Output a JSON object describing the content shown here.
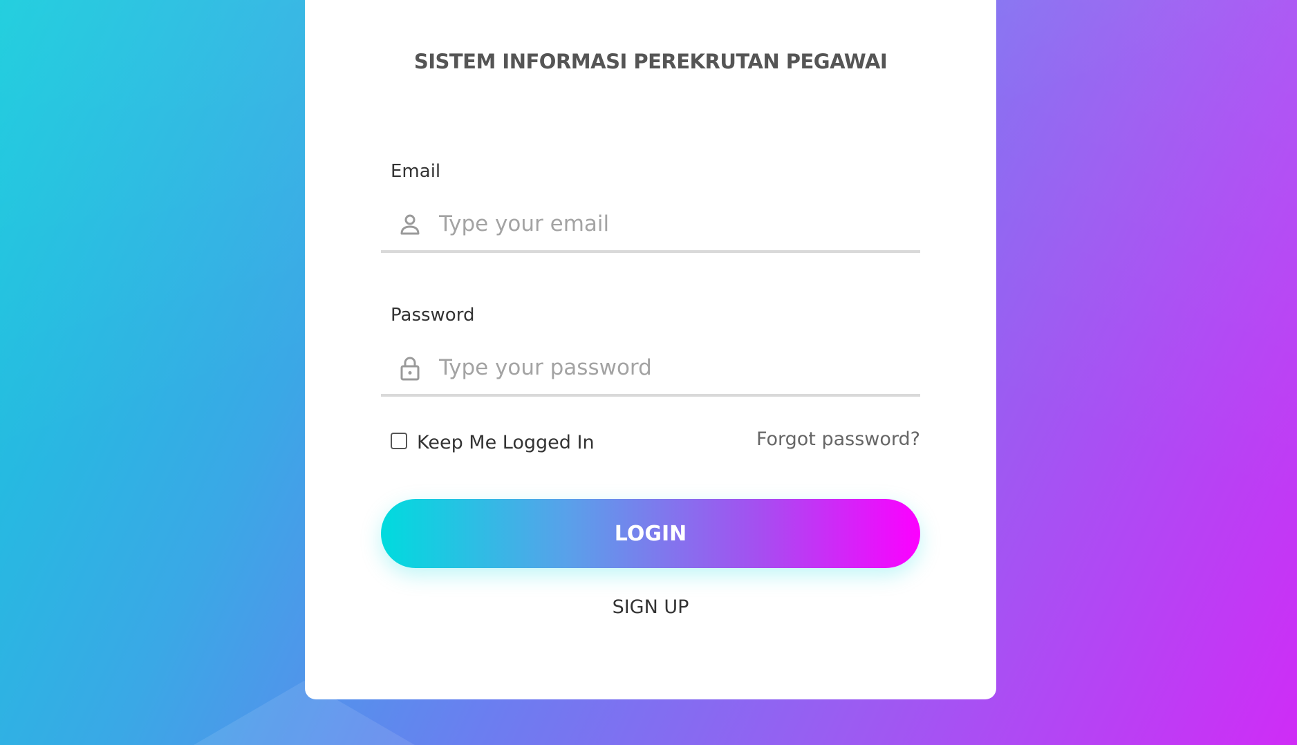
{
  "page": {
    "title": "SISTEM INFORMASI PEREKRUTAN PEGAWAI"
  },
  "form": {
    "email": {
      "label": "Email",
      "placeholder": "Type your email",
      "value": "",
      "icon": "user-icon"
    },
    "password": {
      "label": "Password",
      "placeholder": "Type your password",
      "value": "",
      "icon": "lock-icon"
    },
    "remember_me": {
      "label": "Keep Me Logged In",
      "checked": false
    },
    "forgot_password": "Forgot password?",
    "login_button": "LOGIN",
    "signup_link": "SIGN UP"
  },
  "colors": {
    "background_start": "#12cbdc",
    "background_end": "#cf2cf6",
    "button_gradient_start": "#00dbde",
    "button_gradient_end": "#fc00ff",
    "title_text": "#555555",
    "placeholder_text": "#a3a3a3"
  }
}
